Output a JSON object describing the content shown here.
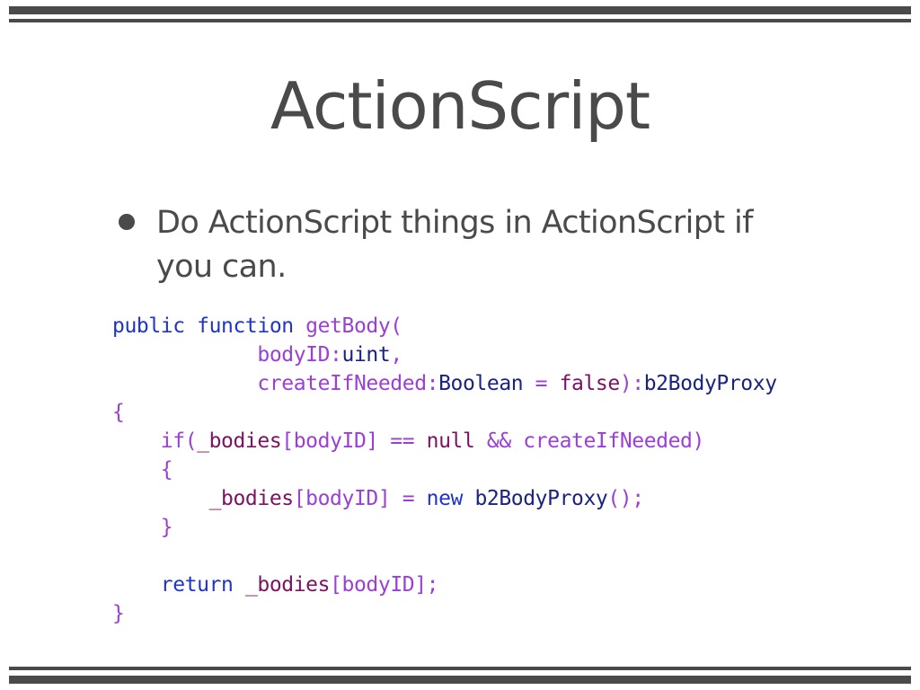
{
  "slide": {
    "title": "ActionScript",
    "bullet": "Do ActionScript things in ActionScript if you can."
  },
  "code": {
    "l1": {
      "a": "public function ",
      "b": "getBody("
    },
    "l2": {
      "indent": "            ",
      "a": "bodyID:",
      "b": "uint",
      "c": ","
    },
    "l3": {
      "indent": "            ",
      "a": "createIfNeeded:",
      "b": "Boolean",
      "c": " = ",
      "d": "false",
      "e": "):",
      "f": "b2BodyProxy"
    },
    "l4": {
      "a": "{"
    },
    "l5": {
      "indent": "    ",
      "a": "if(",
      "b": "_bodies",
      "c": "[bodyID] == ",
      "d": "null",
      "e": " && createIfNeeded)"
    },
    "l6": {
      "indent": "    ",
      "a": "{"
    },
    "l7": {
      "indent": "        ",
      "a": "_bodies",
      "b": "[bodyID] = ",
      "c": "new ",
      "d": "b2BodyProxy",
      "e": "();"
    },
    "l8": {
      "indent": "    ",
      "a": "}"
    },
    "l9": {
      "a": ""
    },
    "l10": {
      "indent": "    ",
      "a": "return ",
      "b": "_bodies",
      "c": "[bodyID];"
    },
    "l11": {
      "a": "}"
    }
  },
  "colors": {
    "keyword": "#1f34c8",
    "punctuation": "#9b3fd6",
    "type": "#1a2380",
    "identifier": "#7a1460",
    "text": "#4a4a4a"
  }
}
